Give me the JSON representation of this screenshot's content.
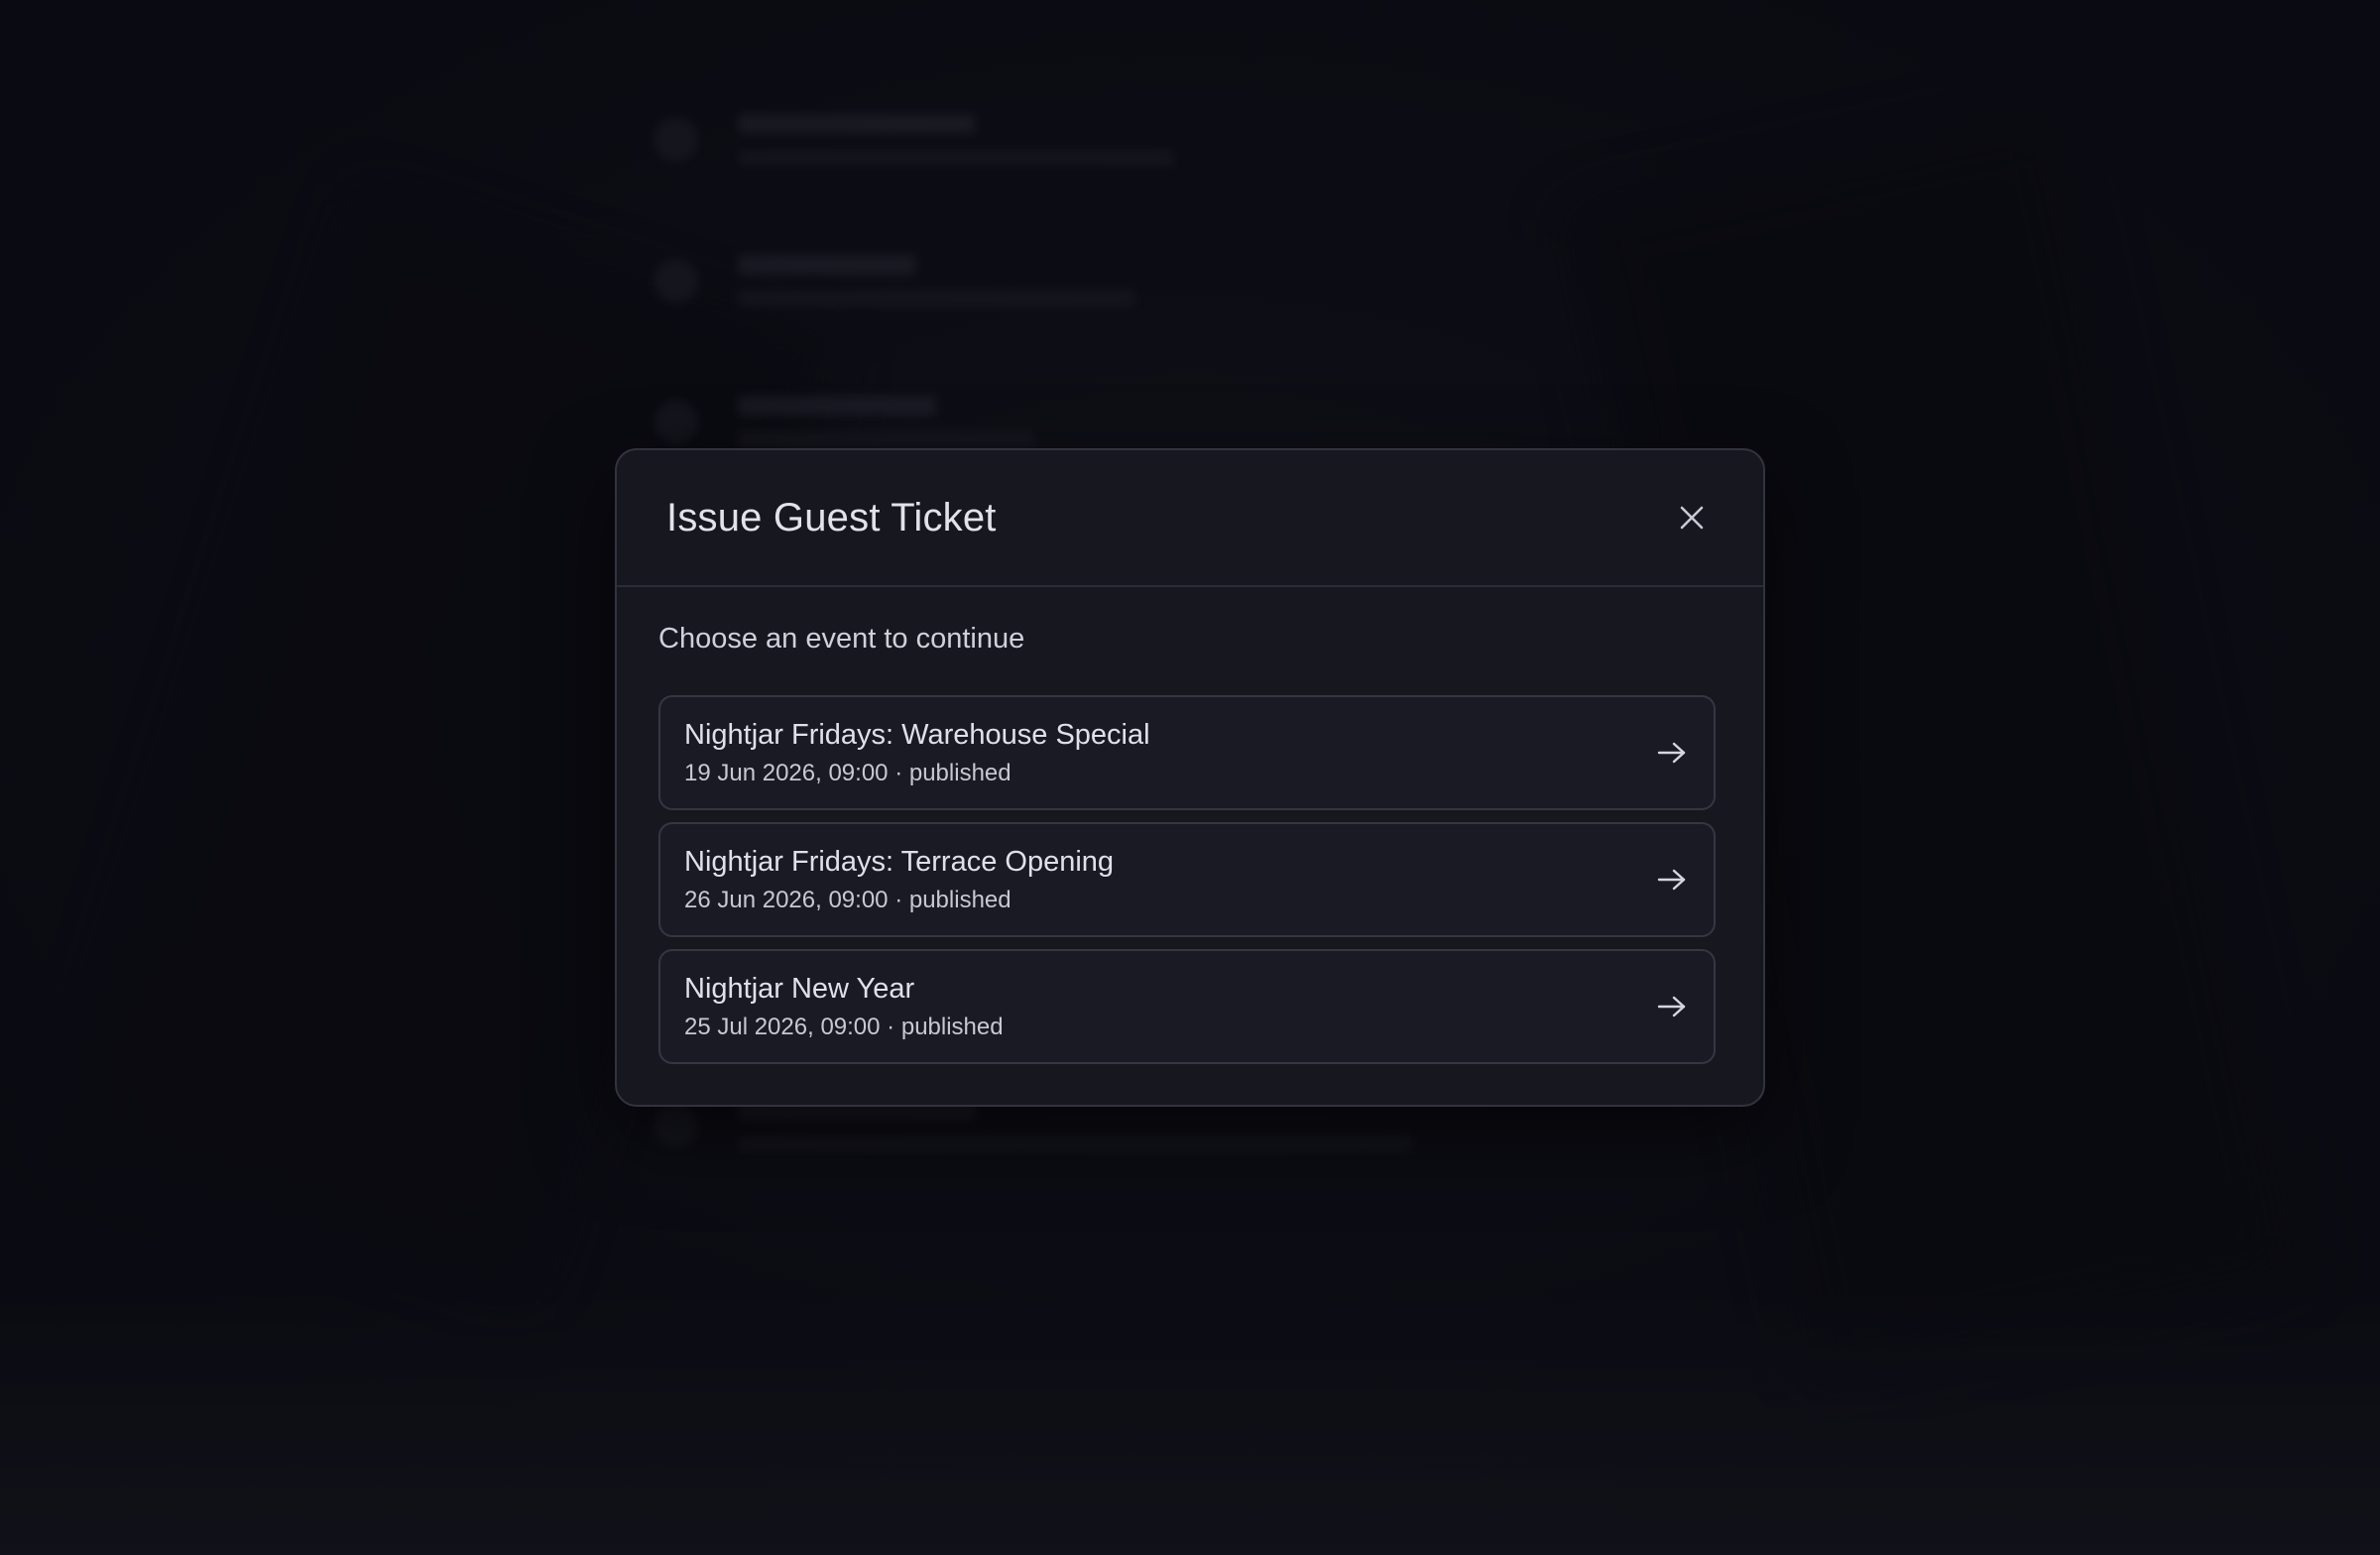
{
  "modal": {
    "title": "Issue Guest Ticket",
    "close_icon": "close-icon",
    "prompt": "Choose an event to continue"
  },
  "events": [
    {
      "name": "Nightjar Fridays: Warehouse Special",
      "datetime": "19 Jun 2026, 09:00",
      "separator": "·",
      "status": "published",
      "icon": "arrow-right-icon"
    },
    {
      "name": "Nightjar Fridays: Terrace Opening",
      "datetime": "26 Jun 2026, 09:00",
      "separator": "·",
      "status": "published",
      "icon": "arrow-right-icon"
    },
    {
      "name": "Nightjar New Year",
      "datetime": "25 Jul 2026, 09:00",
      "separator": "·",
      "status": "published",
      "icon": "arrow-right-icon"
    }
  ],
  "colors": {
    "modal_background": "#171720",
    "modal_border": "#33333f",
    "text_primary": "#e2e2ea",
    "page_background": "#0d0d16"
  }
}
